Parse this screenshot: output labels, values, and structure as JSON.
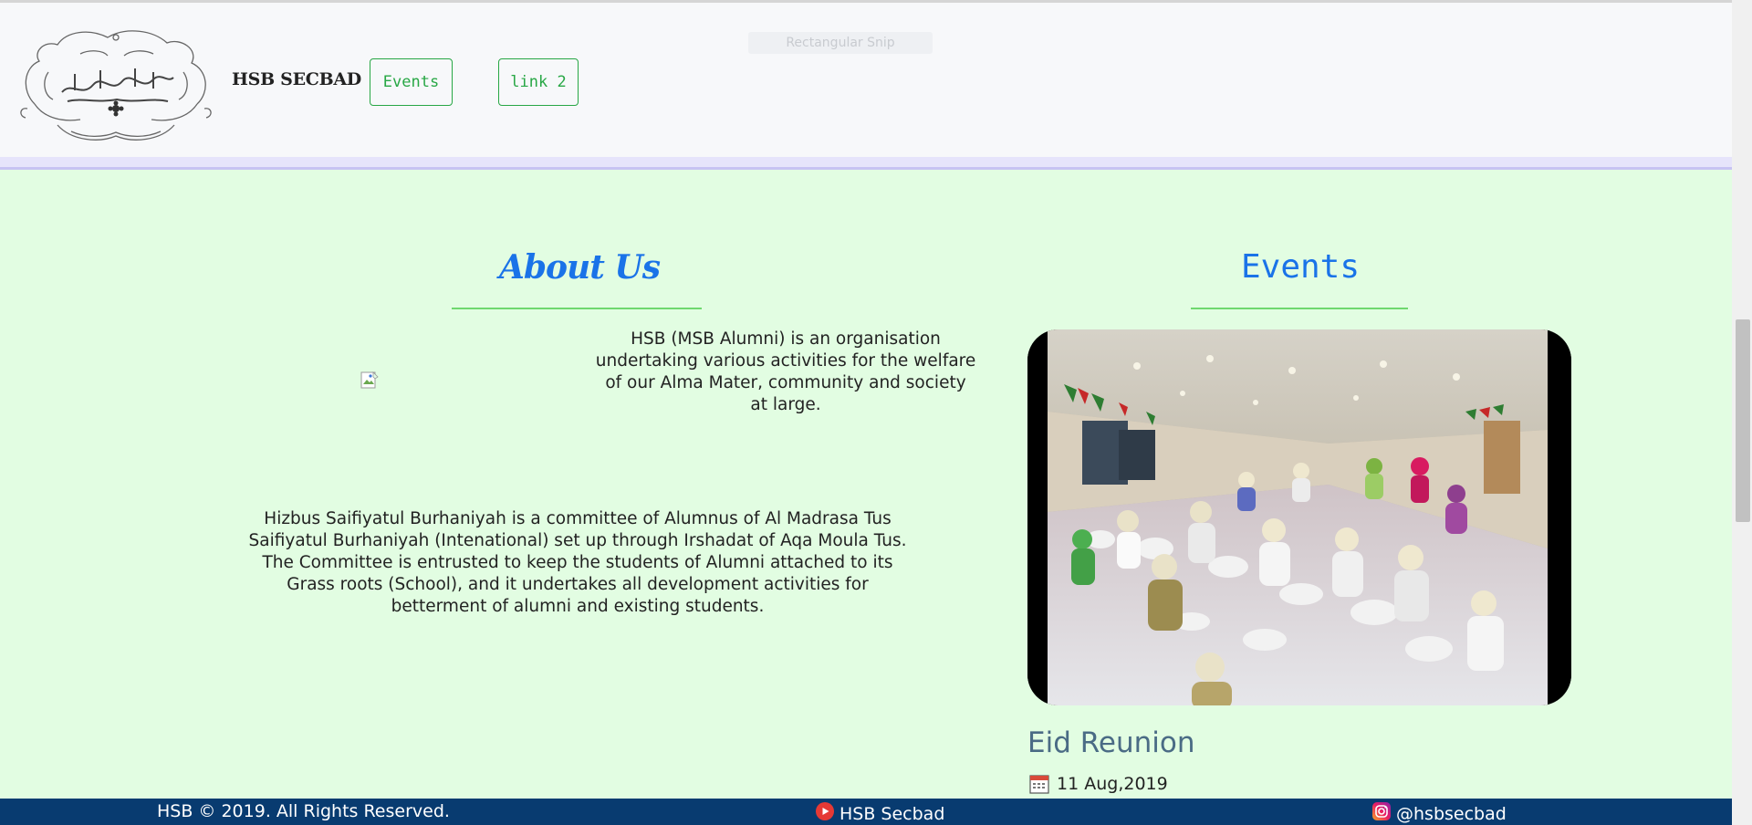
{
  "ghost": {
    "snip_text": "Rectangular Snip"
  },
  "header": {
    "brand": "HSB SECBAD",
    "nav": [
      {
        "label": "Events"
      },
      {
        "label": "link 2"
      }
    ]
  },
  "about": {
    "title": "About Us",
    "intro": "HSB (MSB Alumni) is an organisation undertaking various activities for the welfare of our Alma Mater, community and society at large.",
    "body": "Hizbus Saifiyatul Burhaniyah is a committee of Alumnus of Al Madrasa Tus Saifiyatul Burhaniyah (Intenational) set up through Irshadat of Aqa Moula Tus. The Committee is entrusted to keep the students of Alumni attached to its Grass roots (School), and it undertakes all development activities for betterment of alumni and existing students."
  },
  "events": {
    "title": "Events",
    "item": {
      "name": "Eid Reunion",
      "date": "11 Aug,2019"
    }
  },
  "footer": {
    "copyright": "HSB © 2019. All Rights Reserved.",
    "youtube": "HSB Secbad",
    "instagram": "@hsbsecbad"
  },
  "colors": {
    "page_bg": "#e2fde2",
    "accent_blue": "#1a73e8",
    "nav_green": "#28a745",
    "footer_bg": "#083b70"
  },
  "icons": [
    "logo-calligraphy",
    "broken-image-icon",
    "calendar-icon",
    "youtube-icon",
    "instagram-icon"
  ]
}
